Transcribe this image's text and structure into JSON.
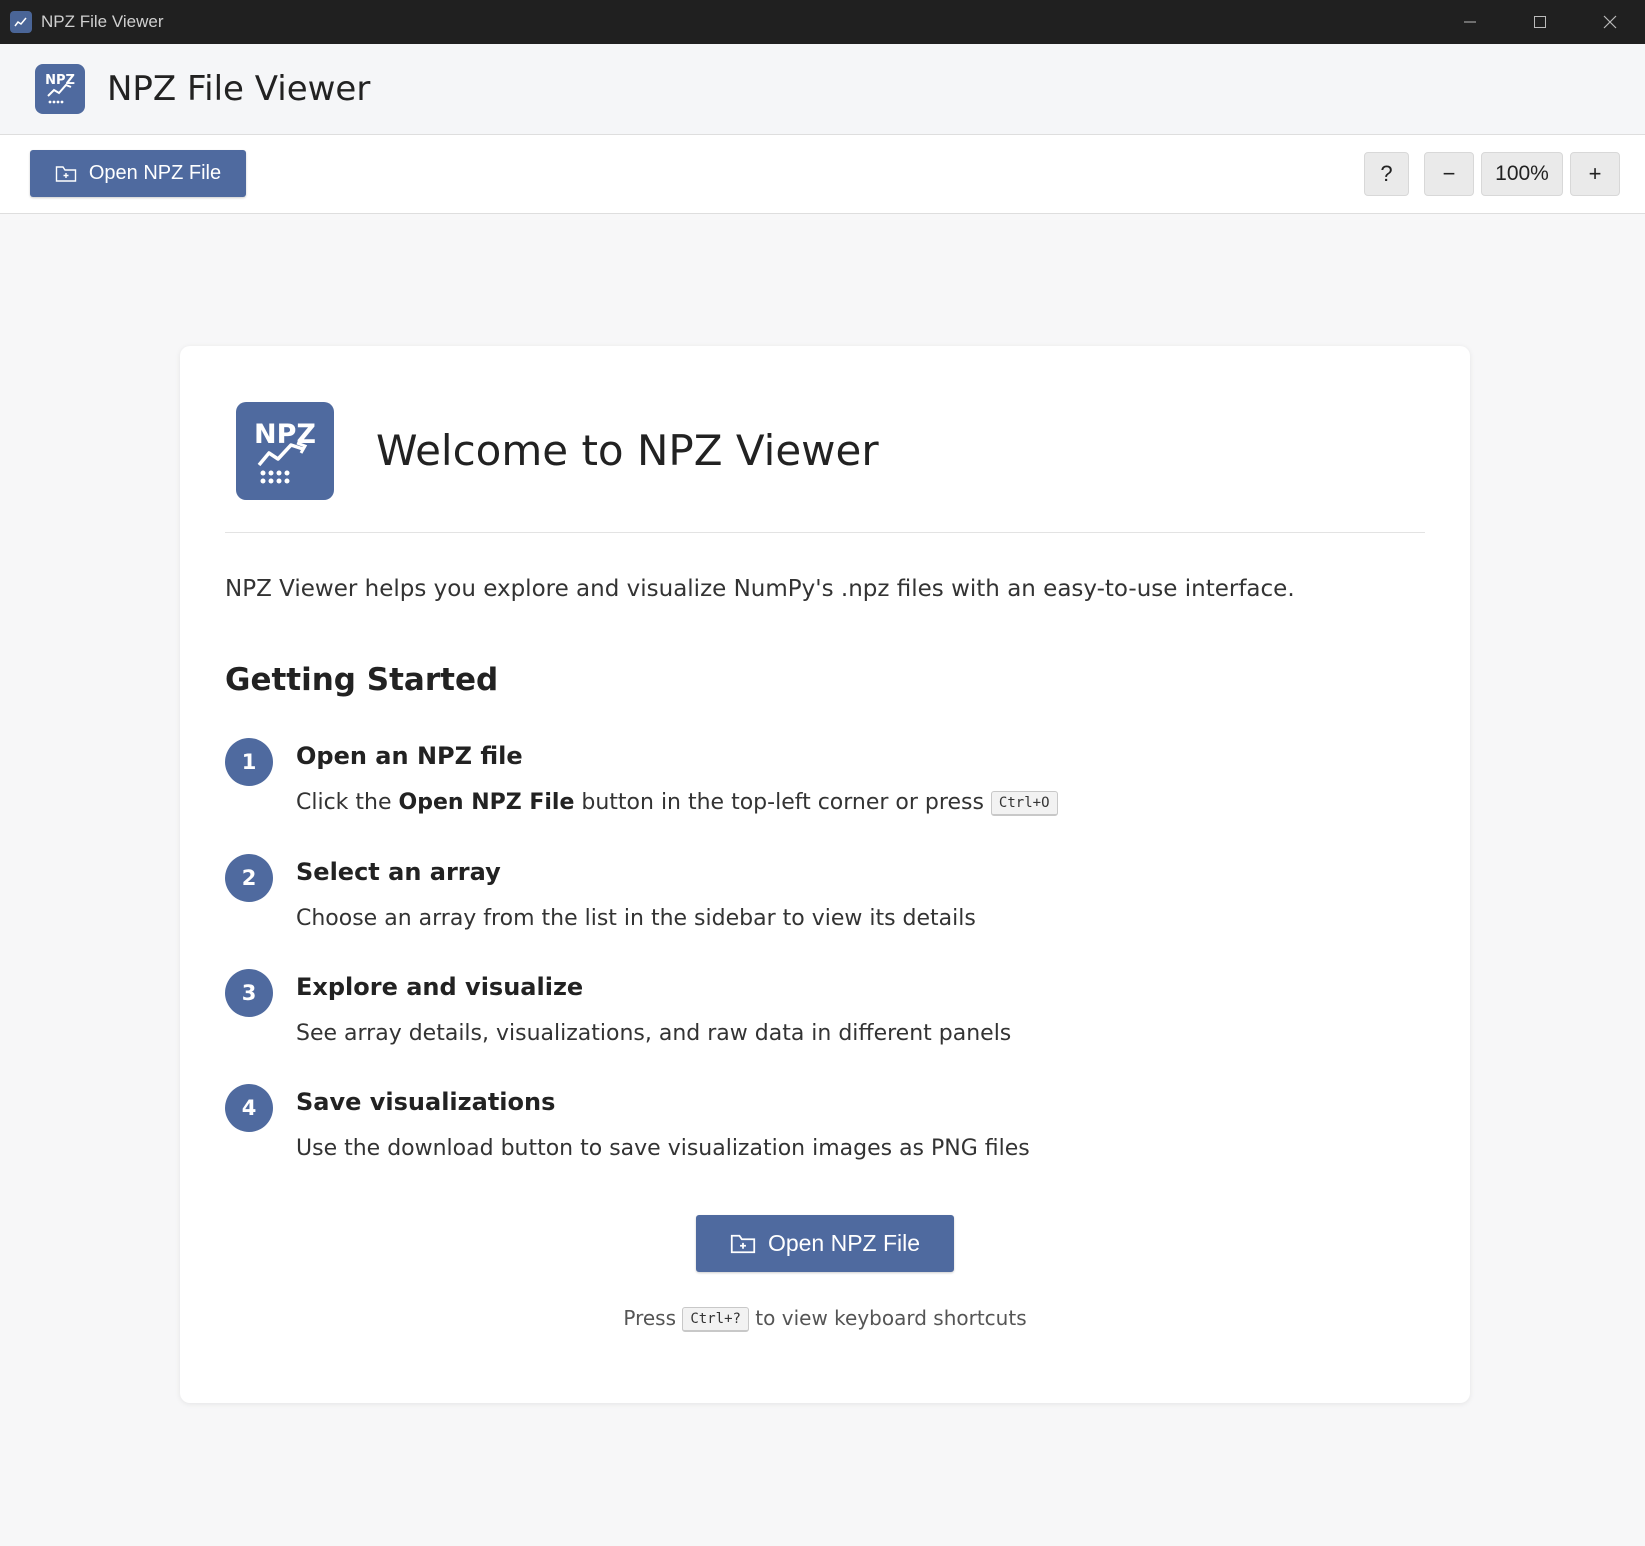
{
  "window": {
    "title": "NPZ File Viewer",
    "controls": [
      "minimize-icon",
      "maximize-icon",
      "close-icon"
    ]
  },
  "header": {
    "logo_text": "NPZ",
    "title": "NPZ File Viewer"
  },
  "toolbar": {
    "open_label": "Open NPZ File",
    "help_label": "?",
    "zoom_out_label": "−",
    "zoom_level": "100%",
    "zoom_in_label": "+"
  },
  "welcome": {
    "logo_text": "NPZ",
    "title": "Welcome to NPZ Viewer",
    "intro": "NPZ Viewer helps you explore and visualize NumPy's .npz files with an easy-to-use interface.",
    "section_title": "Getting Started",
    "steps": [
      {
        "number": "1",
        "title": "Open an NPZ file",
        "desc_prefix": "Click the ",
        "desc_bold": "Open NPZ File",
        "desc_suffix": " button in the top-left corner or press ",
        "shortcut": "Ctrl+O"
      },
      {
        "number": "2",
        "title": "Select an array",
        "desc": "Choose an array from the list in the sidebar to view its details"
      },
      {
        "number": "3",
        "title": "Explore and visualize",
        "desc": "See array details, visualizations, and raw data in different panels"
      },
      {
        "number": "4",
        "title": "Save visualizations",
        "desc": "Use the download button to save visualization images as PNG files"
      }
    ],
    "open_button_label": "Open NPZ File",
    "hint_prefix": "Press ",
    "hint_shortcut": "Ctrl+?",
    "hint_suffix": " to view keyboard shortcuts"
  },
  "colors": {
    "accent": "#4f6a9f",
    "titlebar": "#202020",
    "background": "#f7f7f8"
  }
}
